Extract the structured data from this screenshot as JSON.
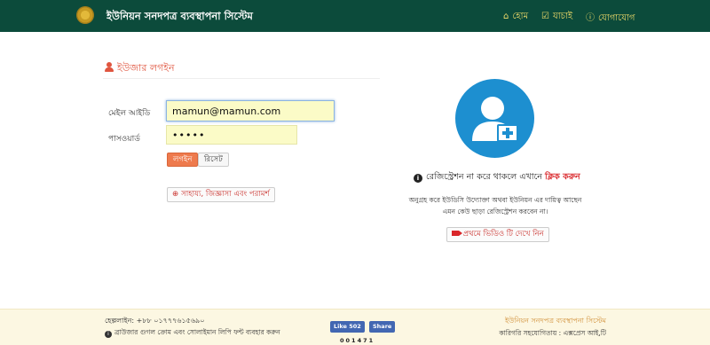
{
  "header": {
    "brand": "ইউনিয়ন সনদপত্র ব্যবস্থাপনা সিস্টেম",
    "nav": {
      "home": "হোম",
      "check": "যাচাই",
      "contact": "যোগাযোগ"
    }
  },
  "login": {
    "title": "ইউজার লগইন",
    "email_label": "মেইল আইডি",
    "email_value": "mamun@mamun.com",
    "password_label": "পাসওয়ার্ড",
    "password_value": "•••••",
    "login_button": "লগইন",
    "reset_button": "রিসেট",
    "help_button": "সাহায্য, জিজ্ঞাসা এবং পরামর্শ"
  },
  "register": {
    "prompt": "রেজিস্ট্রেশন না করে থাকলে এখানে",
    "link": "ক্লিক করুন",
    "note_line1": "অনুগ্রহ করে ইউডিসি উদ্যোক্তা অথবা ইউনিয়ন এর দায়িত্ব আছেন",
    "note_line2": "এমন কেউ ছাড়া রেজিস্ট্রেশন করবেন না।",
    "video_button": "প্রথমে ভিডিও টি দেখে নিন"
  },
  "footer": {
    "helpline": "হেল্পলাইন: +৮৮ ০১৭৭৭৬১৫৬৯০",
    "browser_note": "ব্রাউজার গুগল ক্রোম এবং সোলাইমান লিপি ফন্ট ব্যবহার করুন",
    "fb_like": "Like 502",
    "fb_share": "Share",
    "counter": "001471",
    "system_name": "ইউনিয়ন সনদপত্র ব্যবস্থাপনা সিস্টেম",
    "tech_support": "কারিগরি সহযোগিতায় : এক্সপ্রেস আই,টি"
  },
  "colors": {
    "header_bg": "#0c4b3b",
    "nav_text": "#f2dd6a",
    "accent_red": "#e0553f",
    "avatar_blue": "#1d8fd0",
    "footer_bg": "#fcf7e2"
  },
  "icons": {
    "logo": "union-emblem-icon",
    "home": "home-icon",
    "check": "check-square-icon",
    "contact": "info-circle-icon",
    "user": "user-icon",
    "help": "lifebuoy-icon",
    "avatar": "user-add-icon",
    "video": "video-camera-icon"
  }
}
